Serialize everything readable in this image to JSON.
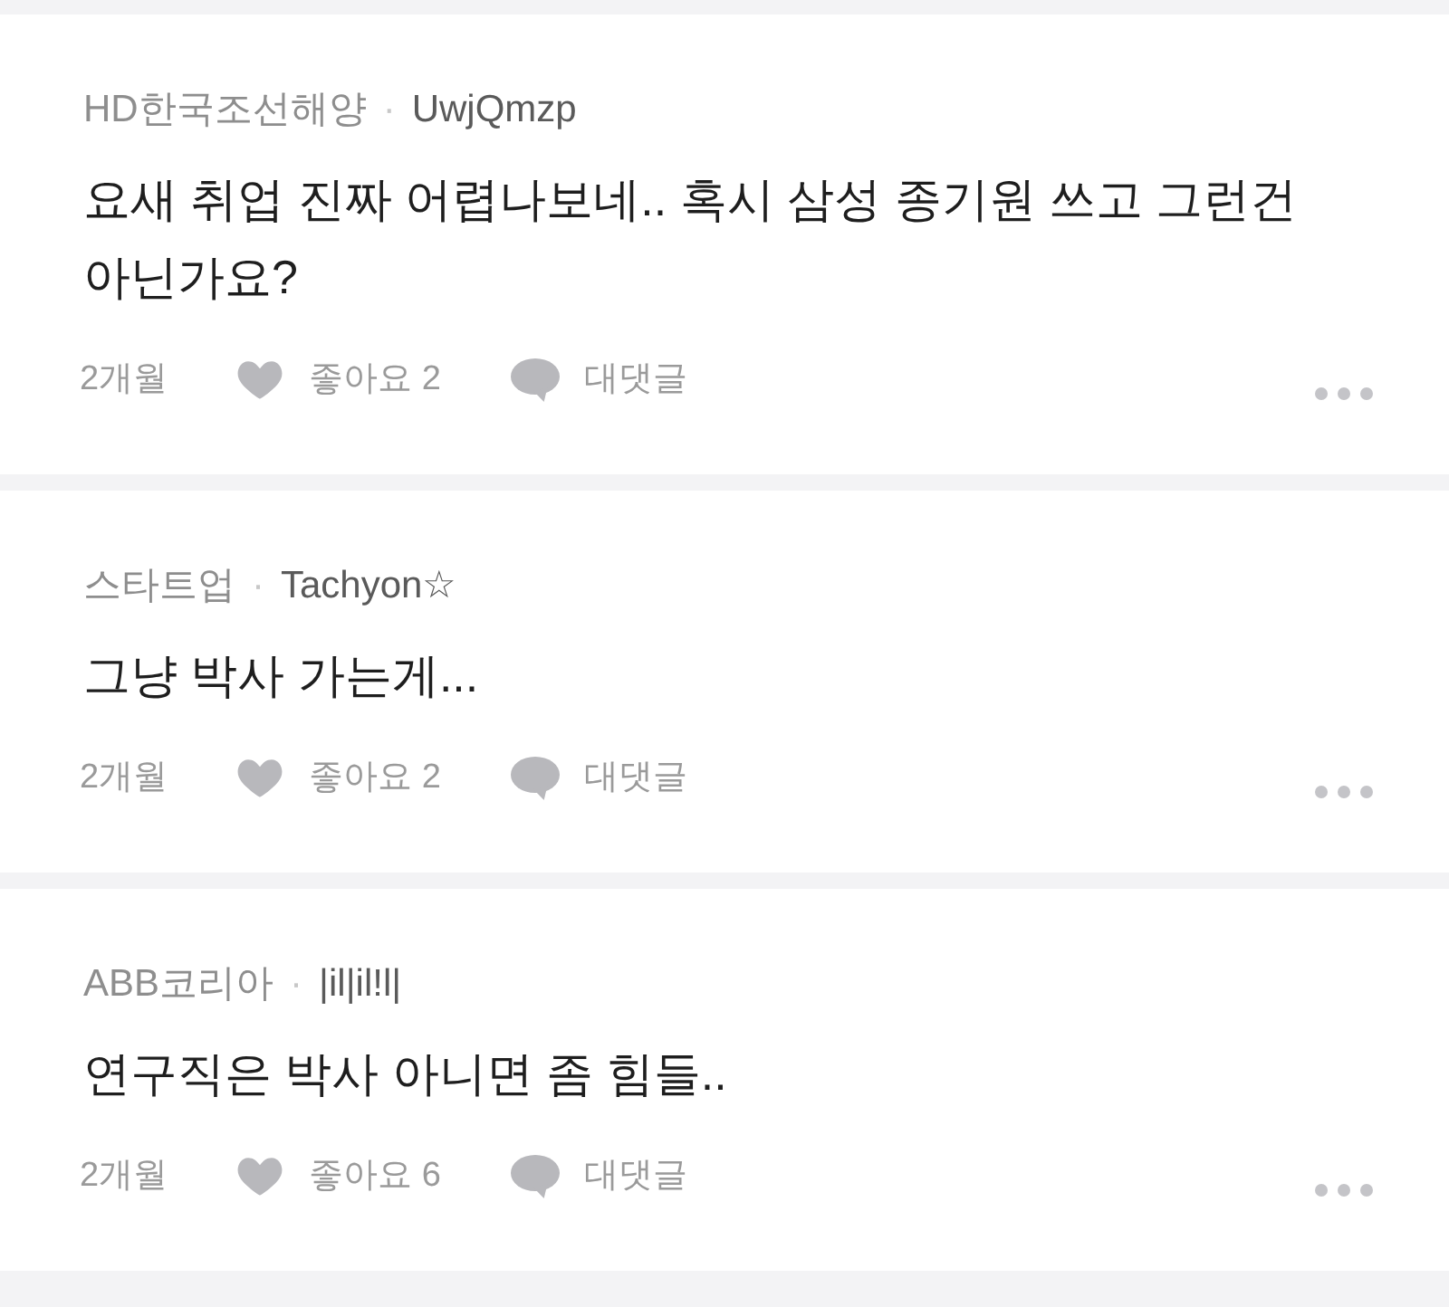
{
  "comments": [
    {
      "company": "HD한국조선해양",
      "separator": "·",
      "author": "UwjQmzp",
      "text": "요새 취업 진짜 어렵나보네.. 혹시 삼성 종기원 쓰고 그런건 아닌가요?",
      "time": "2개월",
      "likes": "좋아요 2",
      "reply": "대댓글"
    },
    {
      "company": "스타트업",
      "separator": "·",
      "author": "Tachyon☆",
      "text": "그냥 박사 가는게...",
      "time": "2개월",
      "likes": "좋아요 2",
      "reply": "대댓글"
    },
    {
      "company": "ABB코리아",
      "separator": "·",
      "author": "|il|il!l|",
      "text": "연구직은 박사 아니면 좀 힘들..",
      "time": "2개월",
      "likes": "좋아요 6",
      "reply": "대댓글"
    }
  ]
}
